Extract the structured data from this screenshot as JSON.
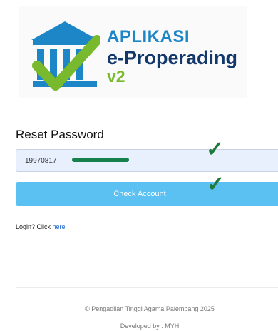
{
  "logo": {
    "line1": "APLIKASI",
    "line2": "e-Properading",
    "line3": "v2",
    "icon": "courthouse-check-icon"
  },
  "form": {
    "title": "Reset Password",
    "field_value": "19970817",
    "button_label": "Check Account"
  },
  "login": {
    "prefix": "Login? Click ",
    "link_text": "here"
  },
  "footer": {
    "copyright": "© Pengadilan Tinggi Agama Palembang 2025",
    "developer": "Developed by : MYH"
  },
  "colors": {
    "brand_blue": "#1d86c7",
    "brand_navy": "#12376b",
    "brand_green": "#79b92d",
    "button": "#5bc0f2",
    "field_bg": "#e8f0fe"
  }
}
